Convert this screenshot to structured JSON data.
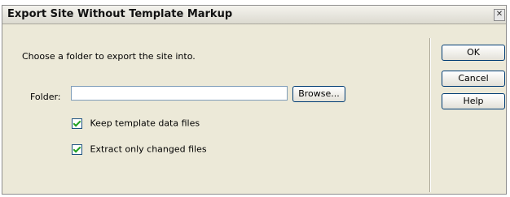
{
  "window": {
    "title": "Export Site Without Template Markup"
  },
  "description": "Choose a folder to export the site into.",
  "folder": {
    "label": "Folder:",
    "value": "",
    "placeholder": ""
  },
  "buttons": {
    "browse": "Browse...",
    "ok": "OK",
    "cancel": "Cancel",
    "help": "Help"
  },
  "options": [
    {
      "label": "Keep template data files",
      "checked": true
    },
    {
      "label": "Extract only changed files",
      "checked": true
    }
  ],
  "colors": {
    "dialog_bg": "#ece9d8",
    "check_mark": "#21a121",
    "input_border": "#7f9db9"
  }
}
